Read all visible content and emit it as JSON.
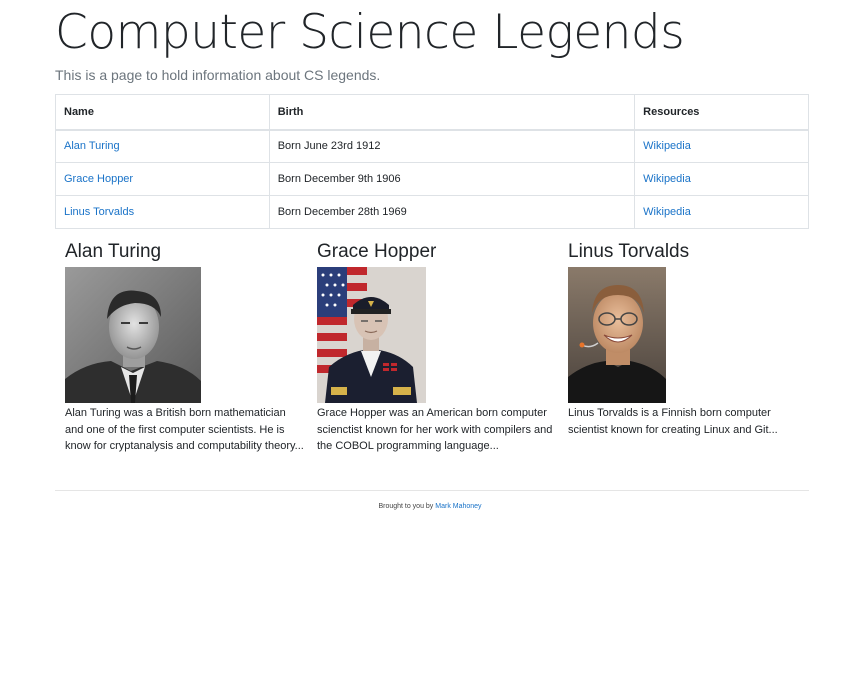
{
  "header": {
    "title": "Computer Science Legends",
    "subtitle": "This is a page to hold information about CS legends."
  },
  "table": {
    "columns": [
      "Name",
      "Birth",
      "Resources"
    ],
    "rows": [
      {
        "name": "Alan Turing",
        "birth": "Born June 23rd 1912",
        "resource": "Wikipedia"
      },
      {
        "name": "Grace Hopper",
        "birth": "Born December 9th 1906",
        "resource": "Wikipedia"
      },
      {
        "name": "Linus Torvalds",
        "birth": "Born December 28th 1969",
        "resource": "Wikipedia"
      }
    ]
  },
  "cards": [
    {
      "name": "Alan Turing",
      "description": "Alan Turing was a British born mathematician and one of the first computer scientists. He is know for cryptanalysis and computability theory..."
    },
    {
      "name": "Grace Hopper",
      "description": "Grace Hopper was an American born computer scienctist known for her work with compilers and the COBOL programming language..."
    },
    {
      "name": "Linus Torvalds",
      "description": "Linus Torvalds is a Finnish born computer scientist known for creating Linux and Git..."
    }
  ],
  "footer": {
    "prefix": "Brought to you by",
    "author": "Mark Mahoney"
  },
  "colors": {
    "link": "#1a73c8",
    "border": "#dee2e6"
  }
}
